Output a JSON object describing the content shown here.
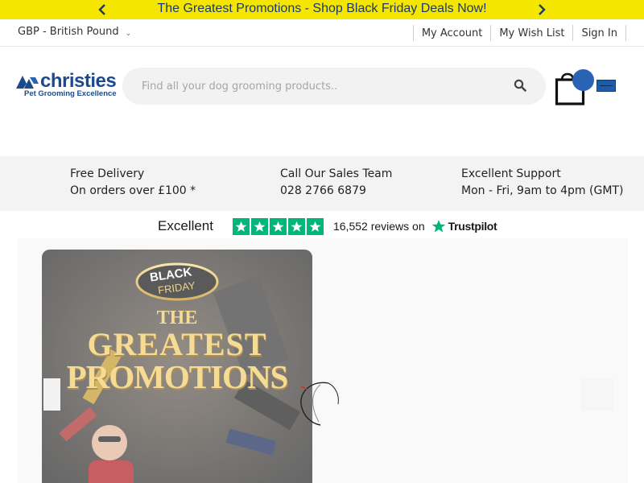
{
  "promo": {
    "text": "The Greatest Promotions - Shop Black Friday Deals Now!",
    "prev_icon": "chevron-left-icon",
    "next_icon": "chevron-right-icon"
  },
  "topbar": {
    "currency": "GBP - British Pound",
    "links": [
      "My Account",
      "My Wish List",
      "Sign In"
    ]
  },
  "header": {
    "logo_word": "christies",
    "logo_tagline": "Pet Grooming Excellence",
    "search_placeholder": "Find all your dog grooming products..",
    "search_icon": "search-icon",
    "cart_icon": "shopping-bag-icon",
    "menu_icon": "menu-icon"
  },
  "info": {
    "delivery_title": "Free Delivery",
    "delivery_text": "On orders over £100 *",
    "sales_title": "Call Our Sales Team",
    "sales_phone": "028 2766 6879",
    "support_title": "Excellent Support",
    "support_hours": "Mon - Fri, 9am to 4pm (GMT)"
  },
  "trustpilot": {
    "rating_word": "Excellent",
    "stars": 5,
    "reviews_text": "16,552 reviews on",
    "brand": "Trustpilot"
  },
  "hero": {
    "badge_line1": "BLACK",
    "badge_line2": "FRIDAY",
    "headline_line1": "THE",
    "headline_line2": "GREATEST",
    "headline_line3": "PROMOTIONS"
  },
  "colors": {
    "promo_bg": "#f5e600",
    "promo_text": "#1b3a6b",
    "brand_blue": "#1c4a8d",
    "trustpilot_green": "#00b67a",
    "info_bg": "#f3f3f3"
  }
}
